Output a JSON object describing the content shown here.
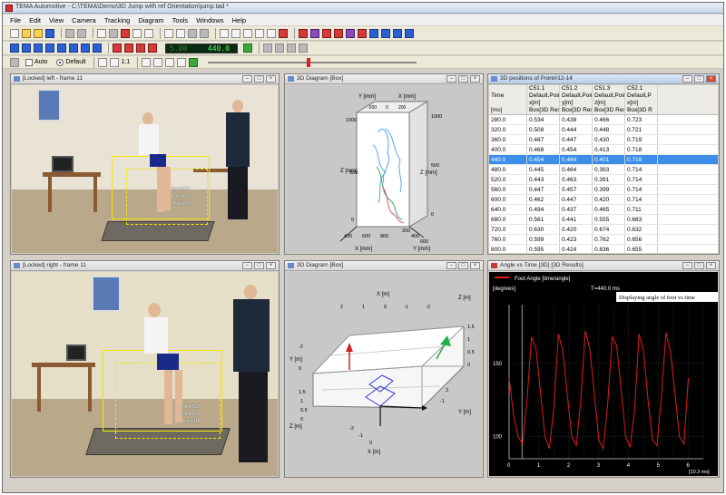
{
  "window": {
    "title": "TEMA Automotive - C:\\TEMA\\Demo\\3D Jump with ref Orientation\\jump.tad *"
  },
  "menu": [
    "File",
    "Edit",
    "View",
    "Camera",
    "Tracking",
    "Diagram",
    "Tools",
    "Windows",
    "Help"
  ],
  "toolbar": {
    "time_display": "440.0",
    "time_display_sub": "5.00",
    "auto_label": "Auto",
    "default_label": "Default",
    "zoom_label": "1:1",
    "slider_position": 0.48
  },
  "panels": {
    "video_left": {
      "title": "[Locked] left - frame 11"
    },
    "video_right": {
      "title": "[Locked] right - frame 11"
    },
    "diagram_top": {
      "title": "3D Diagram [Box]"
    },
    "diagram_bottom": {
      "title": "3D Diagram [Box]"
    },
    "table": {
      "title": "3D positions of Point#12-14"
    },
    "angle": {
      "title": "Angle vs Time [3D] [3D Results]"
    }
  },
  "video_labels": {
    "left_points": [
      "Point#13",
      "Point#12",
      "Point#14"
    ],
    "right_points": [
      "Point#13",
      "Point#12",
      "Point#14"
    ]
  },
  "diagram_top": {
    "y_axis": "Y [mm]",
    "z_axis": "Z [mm]",
    "x_axis": "X [mm]",
    "y_axis2": "Y [mm]",
    "ticks_z": [
      "1000",
      "500",
      "0"
    ],
    "ticks_x": [
      "400",
      "600",
      "800"
    ],
    "ticks_y": [
      "200",
      "400",
      "600"
    ],
    "ticks_top": [
      "-200",
      "0",
      "200"
    ]
  },
  "diagram_bottom": {
    "x_axis": "X [m]",
    "y_axis": "Y [m]",
    "z_axis": "Z [m]",
    "ticks": [
      "-2",
      "-1",
      "0",
      "1",
      "2",
      "1.5",
      "1",
      "0.5",
      "0"
    ]
  },
  "table": {
    "headers": {
      "col0": [
        "Time",
        "",
        "[ms]"
      ],
      "cols": [
        [
          "C51.1",
          "Default,Point#12",
          "x[m]",
          "Box[3D Results]"
        ],
        [
          "C51.2",
          "Default,Point#12",
          "y[m]",
          "Box[3D Results]"
        ],
        [
          "C51.3",
          "Default,Point#12",
          "z[m]",
          "Box[3D Results]"
        ],
        [
          "C52.1",
          "Default,P",
          "x[m]",
          "Box[3D R"
        ]
      ]
    },
    "rows": [
      [
        "280.0",
        "0.534",
        "0.438",
        "0.466",
        "0.723"
      ],
      [
        "320.0",
        "0.508",
        "0.444",
        "0.448",
        "0.721"
      ],
      [
        "360.0",
        "0.487",
        "0.447",
        "0.430",
        "0.719"
      ],
      [
        "400.0",
        "0.468",
        "0.454",
        "0.413",
        "0.718"
      ],
      [
        "440.0",
        "0.454",
        "0.464",
        "0.401",
        "0.716"
      ],
      [
        "480.0",
        "0.445",
        "0.464",
        "0.393",
        "0.714"
      ],
      [
        "520.0",
        "0.443",
        "0.463",
        "0.391",
        "0.714"
      ],
      [
        "560.0",
        "0.447",
        "0.457",
        "0.399",
        "0.714"
      ],
      [
        "600.0",
        "0.462",
        "0.447",
        "0.420",
        "0.714"
      ],
      [
        "640.0",
        "0.494",
        "0.437",
        "0.465",
        "0.711"
      ],
      [
        "680.0",
        "0.561",
        "0.441",
        "0.555",
        "0.683"
      ],
      [
        "720.0",
        "0.630",
        "0.420",
        "0.674",
        "0.632"
      ],
      [
        "760.0",
        "0.599",
        "0.423",
        "0.762",
        "0.656"
      ],
      [
        "800.0",
        "0.595",
        "0.424",
        "0.836",
        "0.655"
      ],
      [
        "840.0",
        "0.555",
        "0.422",
        "0.895",
        "0.640"
      ]
    ],
    "selected_row": 4
  },
  "angle_chart": {
    "legend": "Foot Angle [time/angle]",
    "time_marker": "T=440.0 ms",
    "annotation": "Displaying angle of foot vs time",
    "y_unit": "[degrees]",
    "x_unit": "[10.3 ms]",
    "y_ticks": [
      "150",
      "100"
    ],
    "x_ticks": [
      "0",
      "1",
      "2",
      "3",
      "4",
      "5",
      "6"
    ],
    "line_color": "#e11b1b"
  },
  "chart_data": {
    "type": "line",
    "title": "",
    "xlabel": "[10.3 ms]",
    "ylabel": "[degrees]",
    "xlim": [
      0,
      6.5
    ],
    "ylim": [
      85,
      190
    ],
    "series": [
      {
        "name": "Foot Angle [time/angle]",
        "x": [
          0.0,
          0.15,
          0.3,
          0.45,
          0.6,
          0.75,
          0.9,
          1.05,
          1.2,
          1.35,
          1.5,
          1.65,
          1.8,
          1.95,
          2.1,
          2.25,
          2.4,
          2.55,
          2.7,
          2.85,
          3.0,
          3.15,
          3.3,
          3.45,
          3.6,
          3.75,
          3.9,
          4.05,
          4.2,
          4.35,
          4.5,
          4.65,
          4.8,
          4.95,
          5.1,
          5.25,
          5.4,
          5.55,
          5.7,
          5.85,
          6.0
        ],
        "y": [
          140,
          115,
          100,
          95,
          125,
          168,
          160,
          130,
          100,
          92,
          120,
          170,
          158,
          128,
          100,
          94,
          125,
          172,
          160,
          130,
          98,
          92,
          122,
          168,
          162,
          132,
          100,
          93,
          118,
          170,
          158,
          125,
          98,
          94,
          128,
          171,
          158,
          130,
          100,
          95,
          140
        ]
      }
    ]
  }
}
